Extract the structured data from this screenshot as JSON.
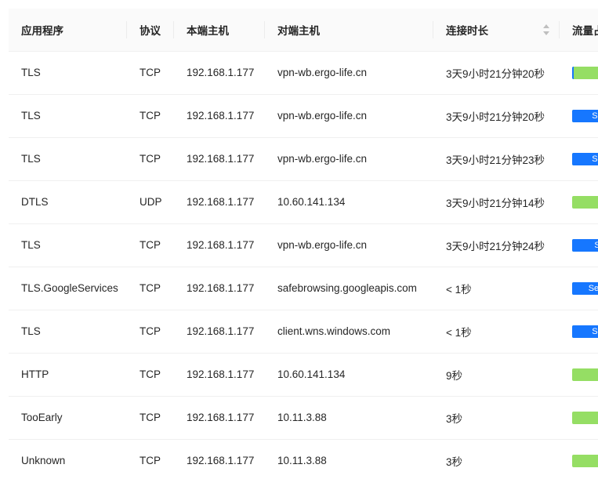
{
  "table": {
    "columns": {
      "app": "应用程序",
      "protocol": "协议",
      "local_host": "本端主机",
      "remote_host": "对端主机",
      "duration": "连接时长",
      "traffic": "流量占比"
    },
    "rows": [
      {
        "app": "TLS",
        "protocol": "TCP",
        "local_host": "192.168.1.177",
        "remote_host": "vpn-wb.ergo-life.cn",
        "duration": "3天9小时21分钟20秒",
        "traffic_fill": 0.03,
        "traffic_label": ""
      },
      {
        "app": "TLS",
        "protocol": "TCP",
        "local_host": "192.168.1.177",
        "remote_host": "vpn-wb.ergo-life.cn",
        "duration": "3天9小时21分钟20秒",
        "traffic_fill": 1.0,
        "traffic_label": "Se"
      },
      {
        "app": "TLS",
        "protocol": "TCP",
        "local_host": "192.168.1.177",
        "remote_host": "vpn-wb.ergo-life.cn",
        "duration": "3天9小时21分钟23秒",
        "traffic_fill": 1.0,
        "traffic_label": "Se"
      },
      {
        "app": "DTLS",
        "protocol": "UDP",
        "local_host": "192.168.1.177",
        "remote_host": "10.60.141.134",
        "duration": "3天9小时21分钟14秒",
        "traffic_fill": 0.0,
        "traffic_label": ""
      },
      {
        "app": "TLS",
        "protocol": "TCP",
        "local_host": "192.168.1.177",
        "remote_host": "vpn-wb.ergo-life.cn",
        "duration": "3天9小时21分钟24秒",
        "traffic_fill": 1.0,
        "traffic_label": "S"
      },
      {
        "app": "TLS.GoogleServices",
        "protocol": "TCP",
        "local_host": "192.168.1.177",
        "remote_host": "safebrowsing.googleapis.com",
        "duration": "< 1秒",
        "traffic_fill": 1.0,
        "traffic_label": "Serv"
      },
      {
        "app": "TLS",
        "protocol": "TCP",
        "local_host": "192.168.1.177",
        "remote_host": "client.wns.windows.com",
        "duration": "< 1秒",
        "traffic_fill": 1.0,
        "traffic_label": "Se"
      },
      {
        "app": "HTTP",
        "protocol": "TCP",
        "local_host": "192.168.1.177",
        "remote_host": "10.60.141.134",
        "duration": "9秒",
        "traffic_fill": 0.0,
        "traffic_label": ""
      },
      {
        "app": "TooEarly",
        "protocol": "TCP",
        "local_host": "192.168.1.177",
        "remote_host": "10.11.3.88",
        "duration": "3秒",
        "traffic_fill": 0.0,
        "traffic_label": ""
      },
      {
        "app": "Unknown",
        "protocol": "TCP",
        "local_host": "192.168.1.177",
        "remote_host": "10.11.3.88",
        "duration": "3秒",
        "traffic_fill": 0.0,
        "traffic_label": ""
      }
    ]
  },
  "colors": {
    "header_bg": "#fafafa",
    "row_border": "#f0f0f0",
    "bar_green": "#95de64",
    "bar_blue": "#1677ff"
  },
  "icons": {
    "duration_sort": "sort-caret-icon"
  }
}
